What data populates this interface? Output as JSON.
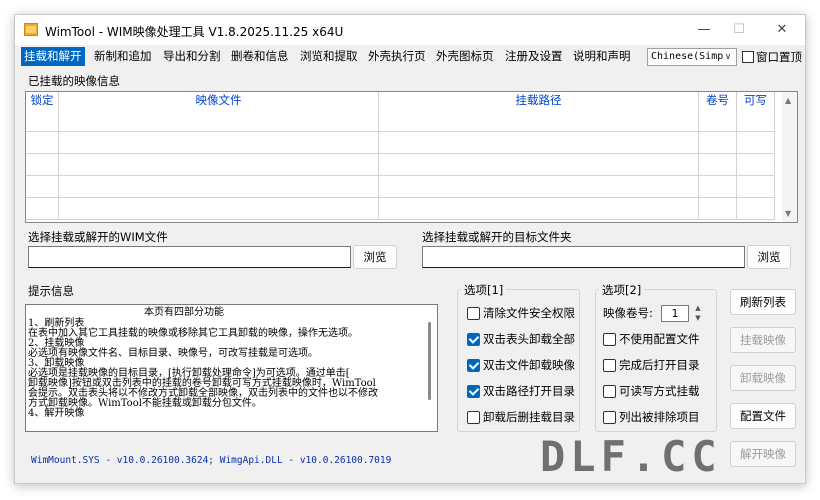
{
  "window": {
    "title": "WimTool - WIM映像处理工具 V1.8.2025.11.25 x64U",
    "minimize": "—",
    "maximize": "☐",
    "close": "✕"
  },
  "menu": {
    "items": [
      "挂载和解开",
      "新制和追加",
      "导出和分割",
      "删卷和信息",
      "浏览和提取",
      "外壳执行页",
      "外壳图标页",
      "注册及设置",
      "说明和声明"
    ],
    "active_index": 0,
    "language": "Chinese(Simp",
    "topmost_label": "窗口置顶"
  },
  "mounted": {
    "label": "已挂载的映像信息",
    "columns": [
      "锁定",
      "映像文件",
      "挂载路径",
      "卷号",
      "可写"
    ],
    "rows": []
  },
  "wim_select": {
    "label": "选择挂载或解开的WIM文件",
    "value": "",
    "browse_label": "浏览"
  },
  "dir_select": {
    "label": "选择挂载或解开的目标文件夹",
    "value": "",
    "browse_label": "浏览"
  },
  "tips": {
    "label": "提示信息",
    "lines": [
      "本页有四部分功能",
      "1、刷新列表",
      "   在表中加入其它工具挂载的映像或移除其它工具卸载的映像，操作无选项。",
      "2、挂载映像",
      "   必选项有映像文件名、目标目录、映像号，可改写挂载是可选项。",
      "3、卸载映像",
      "   必选项是挂载映像的目标目录，[执行卸载处理命令]为可选项。通过单击[",
      "卸载映像]按钮或双击列表中的挂载的卷号卸载可写方式挂载映像时，WimTool",
      "会提示。双击表头将以不修改方式卸载全部映像，双击列表中的文件也以不修改",
      "方式卸载映像。WimTool不能挂载或卸载分包文件。",
      "4、解开映像"
    ]
  },
  "options1": {
    "title": "选项[1]",
    "items": [
      {
        "label": "清除文件安全权限",
        "checked": false
      },
      {
        "label": "双击表头卸载全部",
        "checked": true
      },
      {
        "label": "双击文件卸载映像",
        "checked": true
      },
      {
        "label": "双击路径打开目录",
        "checked": true
      },
      {
        "label": "卸载后删挂载目录",
        "checked": false
      }
    ]
  },
  "options2": {
    "title": "选项[2]",
    "volume_label": "映像卷号:",
    "volume_value": "1",
    "items": [
      {
        "label": "不使用配置文件",
        "checked": false
      },
      {
        "label": "完成后打开目录",
        "checked": false
      },
      {
        "label": "可读写方式挂载",
        "checked": false
      },
      {
        "label": "列出被排除项目",
        "checked": false
      }
    ]
  },
  "actions": {
    "refresh": "刷新列表",
    "mount": "挂载映像",
    "unmount": "卸载映像",
    "config": "配置文件",
    "extract": "解开映像"
  },
  "status": "WimMount.SYS - v10.0.26100.3624; WimgApi.DLL - v10.0.26100.7019",
  "watermark": "DLF.CC",
  "colors": {
    "accent": "#0067c0",
    "header_text": "#0044cc",
    "status_text": "#0a2fa8"
  }
}
